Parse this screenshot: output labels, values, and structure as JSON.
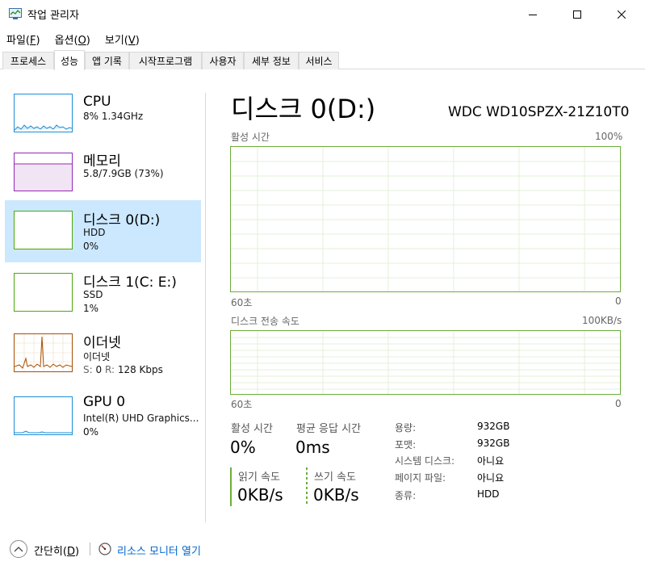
{
  "window": {
    "title": "작업 관리자",
    "app_icon": "task-manager-icon"
  },
  "menu": [
    {
      "label": "파일",
      "key": "F"
    },
    {
      "label": "옵션",
      "key": "O"
    },
    {
      "label": "보기",
      "key": "V"
    }
  ],
  "tabs": [
    "프로세스",
    "성능",
    "앱 기록",
    "시작프로그램",
    "사용자",
    "세부 정보",
    "서비스"
  ],
  "active_tab": "성능",
  "resources": [
    {
      "name": "CPU",
      "line1": "8%  1.34GHz",
      "line2": "",
      "color": "#1d8ed6"
    },
    {
      "name": "메모리",
      "line1": "5.8/7.9GB (73%)",
      "line2": "",
      "color": "#9528b4"
    },
    {
      "name": "디스크 0(D:)",
      "line1": "HDD",
      "line2": "0%",
      "color": "#4da60c"
    },
    {
      "name": "디스크 1(C: E:)",
      "line1": "SSD",
      "line2": "1%",
      "color": "#4da60c"
    },
    {
      "name": "이더넷",
      "line1": "이더넷",
      "line2_s_label": "S:",
      "line2_s": "0",
      "line2_r_label": "R:",
      "line2_r": "128 Kbps",
      "color": "#a74f01"
    },
    {
      "name": "GPU 0",
      "line1": "Intel(R) UHD Graphics...",
      "line2": "0%",
      "color": "#1d8ed6"
    }
  ],
  "detail": {
    "title": "디스크 0(D:)",
    "model": "WDC WD10SPZX-21Z10T0",
    "graph1": {
      "label": "활성 시간",
      "max": "100%",
      "time": "60초",
      "min": "0"
    },
    "graph2": {
      "label": "디스크 전송 속도",
      "max": "100KB/s",
      "time": "60초",
      "min": "0"
    },
    "stats": {
      "active_label": "활성 시간",
      "active_value": "0%",
      "response_label": "평균 응답 시간",
      "response_value": "0ms",
      "read_label": "읽기 속도",
      "read_value": "0KB/s",
      "write_label": "쓰기 속도",
      "write_value": "0KB/s"
    },
    "info": [
      {
        "label": "용량:",
        "value": "932GB"
      },
      {
        "label": "포맷:",
        "value": "932GB"
      },
      {
        "label": "시스템 디스크:",
        "value": "아니요"
      },
      {
        "label": "페이지 파일:",
        "value": "아니요"
      },
      {
        "label": "종류:",
        "value": "HDD"
      }
    ]
  },
  "footer": {
    "simple_label": "간단히",
    "simple_key": "D",
    "monitor_label": "리소스 모니터 열기"
  },
  "colors": {
    "accent_green": "#6cae3a",
    "selected_bg": "#cce8ff",
    "link": "#0066cc"
  }
}
